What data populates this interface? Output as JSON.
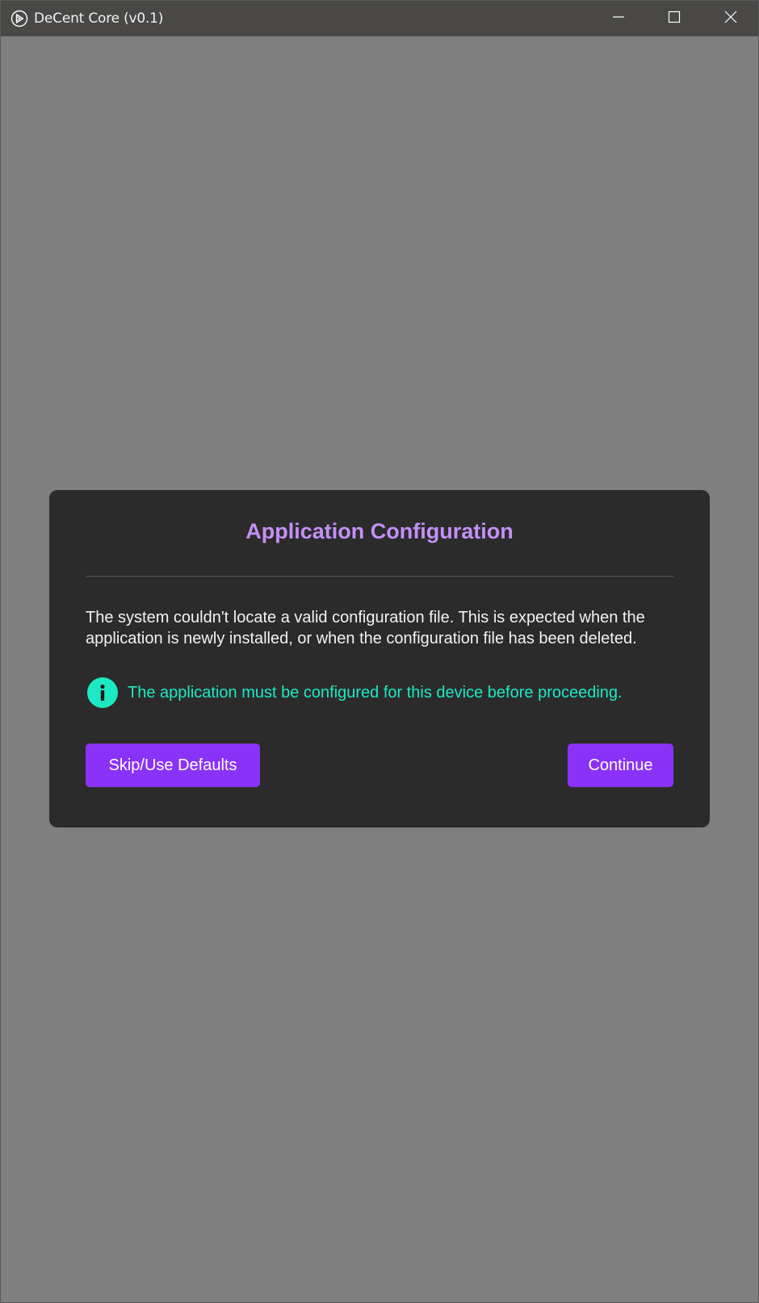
{
  "window": {
    "title": "DeCent Core (v0.1)",
    "app_icon": "decent-logo-icon",
    "controls": {
      "minimize_icon": "minimize-icon",
      "maximize_icon": "maximize-icon",
      "close_icon": "close-icon"
    }
  },
  "dialog": {
    "title": "Application Configuration",
    "body": "The system couldn't locate a valid configuration file. This is expected when the application is newly installed, or when the configuration file has been deleted.",
    "info": {
      "icon": "info-icon",
      "text": "The application must be configured for this device before proceeding."
    },
    "buttons": {
      "skip_label": "Skip/Use Defaults",
      "continue_label": "Continue"
    }
  },
  "colors": {
    "titlebar": "#494846",
    "overlay": "#7f7f7f",
    "dialog_bg": "#2b2b2b",
    "title_accent": "#c390f7",
    "info_accent": "#1de9c4",
    "button_bg": "#8a32f7"
  }
}
